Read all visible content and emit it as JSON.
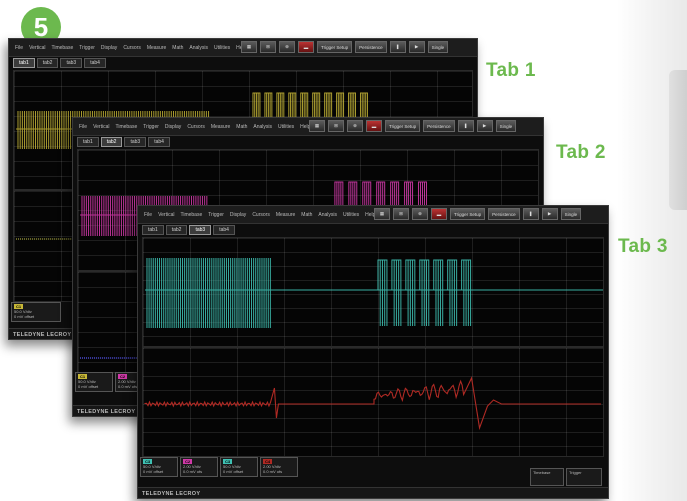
{
  "step_number": "5",
  "tab_labels": [
    "Tab 1",
    "Tab 2",
    "Tab 3"
  ],
  "menu": [
    "File",
    "Vertical",
    "Timebase",
    "Trigger",
    "Display",
    "Cursors",
    "Measure",
    "Math",
    "Analysis",
    "Utilities",
    "Help"
  ],
  "window_tabs": [
    "tab1",
    "tab2",
    "tab3",
    "tab4"
  ],
  "toolbar_labels": {
    "trigger": "Trigger\nSetup",
    "persistence": "Persistence",
    "single": "Single"
  },
  "brand": "TELEDYNE LECROY",
  "colors": {
    "accent": "#6cb94e",
    "trace_yellow": "#c8b838",
    "trace_magenta": "#d03aa8",
    "trace_cyan": "#3fc1b3",
    "trace_red": "#b02a24"
  },
  "channel_boxes": [
    {
      "tag": "C1",
      "color": "#c8b838",
      "lines": "50.0 V/div\n0 mV offset"
    },
    {
      "tag": "C2",
      "color": "#d03aa8",
      "lines": "2.00 V/div\n0.0 mV ofs"
    },
    {
      "tag": "C3",
      "color": "#3fc1b3",
      "lines": "50.0 V/div\n0 mV offset"
    },
    {
      "tag": "C4",
      "color": "#b02a24",
      "lines": "2.00 V/div\n0.0 mV ofs"
    }
  ],
  "timebase": {
    "label": "Timebase",
    "trigger_label": "Trigger"
  }
}
